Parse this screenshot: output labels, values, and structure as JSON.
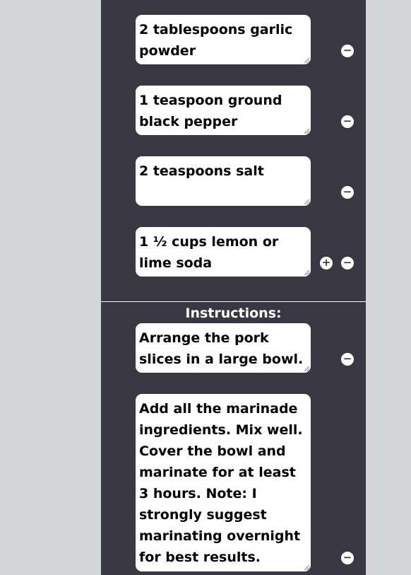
{
  "ingredients": [
    {
      "text": "2 tablespoons garlic powder"
    },
    {
      "text": "1 teaspoon ground black pepper"
    },
    {
      "text": "2 teaspoons salt"
    },
    {
      "text": "1 ½ cups lemon or lime soda"
    }
  ],
  "instructions_heading": "Instructions:",
  "instructions": [
    {
      "text": "Arrange the pork slices in a large bowl."
    },
    {
      "text": "Add all the marinade ingredients. Mix well. Cover the bowl and marinate for at least 3 hours. Note: I strongly suggest marinating overnight for best results."
    }
  ],
  "buttons": {
    "add_glyph": "+",
    "remove_glyph": "−"
  },
  "colors": {
    "panel": "#383742",
    "page_background": "#d3d5d9",
    "field": "#ffffff"
  }
}
